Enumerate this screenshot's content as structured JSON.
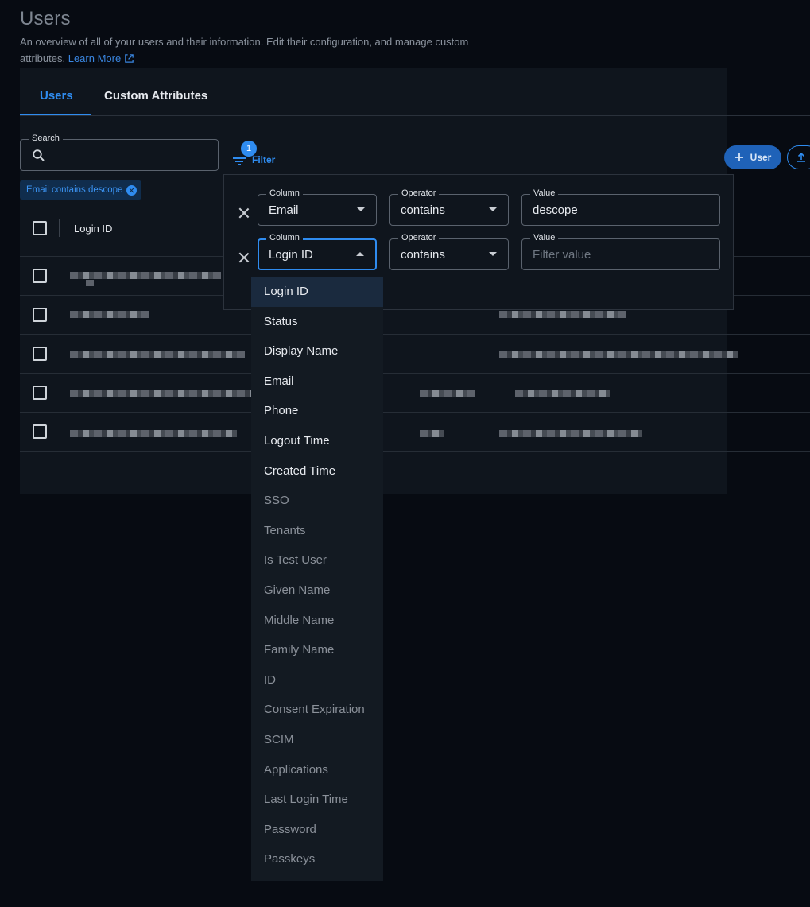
{
  "page": {
    "title": "Users",
    "subtitle": "An overview of all of your users and their information. Edit their configuration, and manage custom attributes.",
    "learn_more": "Learn More"
  },
  "tabs": [
    {
      "label": "Users",
      "active": true
    },
    {
      "label": "Custom Attributes",
      "active": false
    }
  ],
  "toolbar": {
    "search_label": "Search",
    "search_value": "",
    "filter_label": "Filter",
    "filter_count": "1",
    "add_user_label": "User"
  },
  "active_filter_chip": "Email contains descope",
  "table": {
    "columns": [
      "Login ID"
    ],
    "row_count": 5
  },
  "filters": [
    {
      "column_label": "Column",
      "column_value": "Email",
      "operator_label": "Operator",
      "operator_value": "contains",
      "value_label": "Value",
      "value": "descope",
      "value_placeholder": "Filter value"
    },
    {
      "column_label": "Column",
      "column_value": "Login ID",
      "operator_label": "Operator",
      "operator_value": "contains",
      "value_label": "Value",
      "value": "",
      "value_placeholder": "Filter value"
    }
  ],
  "column_options": [
    "Login ID",
    "Status",
    "Display Name",
    "Email",
    "Phone",
    "Logout Time",
    "Created Time",
    "SSO",
    "Tenants",
    "Is Test User",
    "Given Name",
    "Middle Name",
    "Family Name",
    "ID",
    "Consent Expiration",
    "SCIM",
    "Applications",
    "Last Login Time",
    "Password",
    "Passkeys"
  ],
  "colors": {
    "accent": "#2f8cf0",
    "background": "#070b12",
    "panel": "#0f151d"
  }
}
